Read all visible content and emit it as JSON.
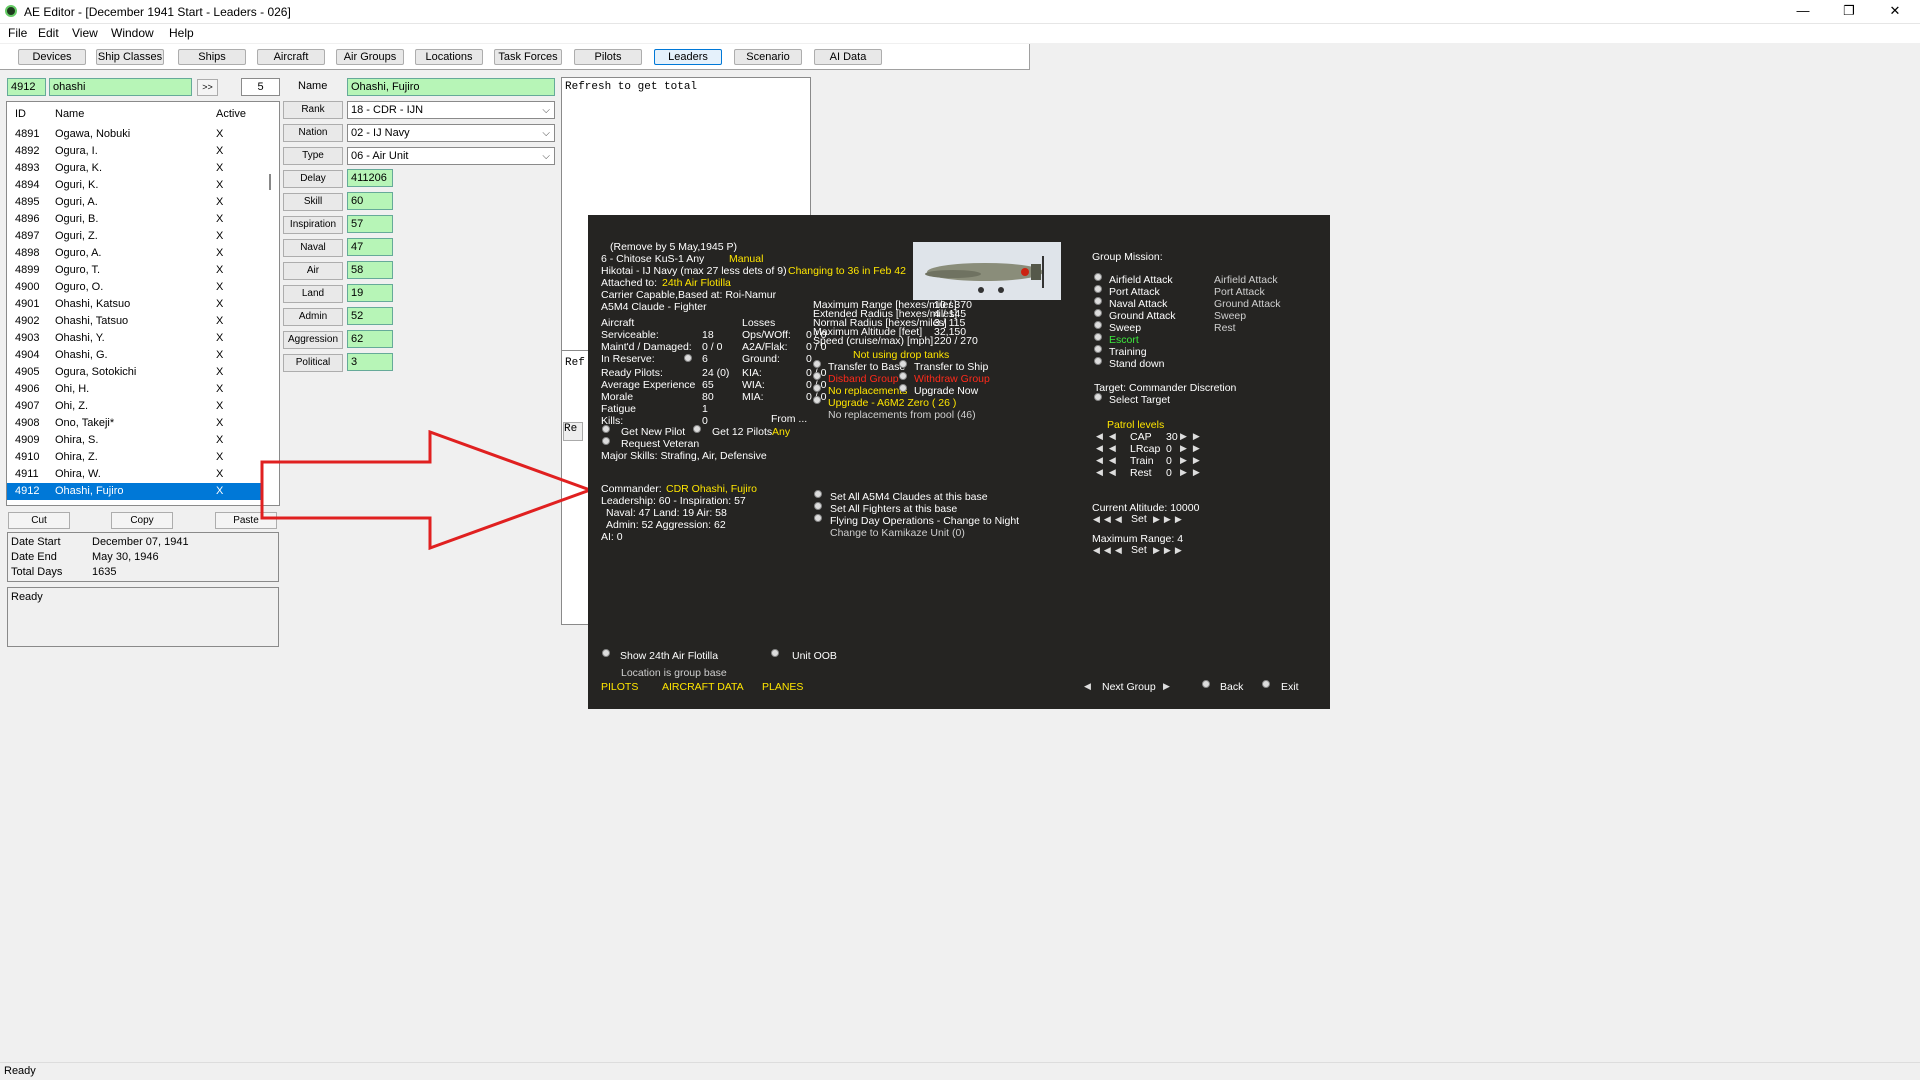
{
  "window": {
    "title": "AE Editor - [December 1941 Start - Leaders - 026]",
    "minimize": "—",
    "maximize": "❐",
    "close": "✕"
  },
  "menu": [
    "File",
    "Edit",
    "View",
    "Window",
    "Help"
  ],
  "tabs": [
    "Devices",
    "Ship Classes",
    "Ships",
    "Aircraft",
    "Air Groups",
    "Locations",
    "Task Forces",
    "Pilots",
    "Leaders",
    "Scenario",
    "AI Data"
  ],
  "active_tab": "Leaders",
  "search": {
    "id": "4912",
    "text": "ohashi",
    "go": ">>",
    "count": "5"
  },
  "list": {
    "headers": [
      "ID",
      "Name",
      "Active"
    ],
    "rows": [
      {
        "id": "4891",
        "name": "Ogawa, Nobuki",
        "active": "X"
      },
      {
        "id": "4892",
        "name": "Ogura, I.",
        "active": "X"
      },
      {
        "id": "4893",
        "name": "Ogura, K.",
        "active": "X"
      },
      {
        "id": "4894",
        "name": "Oguri, K.",
        "active": "X"
      },
      {
        "id": "4895",
        "name": "Oguri, A.",
        "active": "X"
      },
      {
        "id": "4896",
        "name": "Oguri, B.",
        "active": "X"
      },
      {
        "id": "4897",
        "name": "Oguri, Z.",
        "active": "X"
      },
      {
        "id": "4898",
        "name": "Oguro, A.",
        "active": "X"
      },
      {
        "id": "4899",
        "name": "Oguro, T.",
        "active": "X"
      },
      {
        "id": "4900",
        "name": "Oguro, O.",
        "active": "X"
      },
      {
        "id": "4901",
        "name": "Ohashi, Katsuo",
        "active": "X"
      },
      {
        "id": "4902",
        "name": "Ohashi, Tatsuo",
        "active": "X"
      },
      {
        "id": "4903",
        "name": "Ohashi, Y.",
        "active": "X"
      },
      {
        "id": "4904",
        "name": "Ohashi, G.",
        "active": "X"
      },
      {
        "id": "4905",
        "name": "Ogura, Sotokichi",
        "active": "X"
      },
      {
        "id": "4906",
        "name": "Ohi, H.",
        "active": "X"
      },
      {
        "id": "4907",
        "name": "Ohi, Z.",
        "active": "X"
      },
      {
        "id": "4908",
        "name": "Ono, Takeji*",
        "active": "X"
      },
      {
        "id": "4909",
        "name": "Ohira, S.",
        "active": "X"
      },
      {
        "id": "4910",
        "name": "Ohira, Z.",
        "active": "X"
      },
      {
        "id": "4911",
        "name": "Ohira, W.",
        "active": "X"
      },
      {
        "id": "4912",
        "name": "Ohashi, Fujiro",
        "active": "X"
      }
    ]
  },
  "buttons": {
    "cut": "Cut",
    "copy": "Copy",
    "paste": "Paste"
  },
  "dates": {
    "start_label": "Date Start",
    "start": "December 07, 1941",
    "end_label": "Date End",
    "end": "May 30, 1946",
    "days_label": "Total Days",
    "days": "1635"
  },
  "notes": "Ready",
  "form": {
    "name_label": "Name",
    "name": "Ohashi, Fujiro",
    "rank_label": "Rank",
    "rank": "18 - CDR - IJN",
    "nation_label": "Nation",
    "nation": "02 - IJ Navy",
    "type_label": "Type",
    "type": "06 - Air Unit",
    "fields": [
      {
        "label": "Delay",
        "value": "411206"
      },
      {
        "label": "Skill",
        "value": "60"
      },
      {
        "label": "Inspiration",
        "value": "57"
      },
      {
        "label": "Naval",
        "value": "47"
      },
      {
        "label": "Air",
        "value": "58"
      },
      {
        "label": "Land",
        "value": "19"
      },
      {
        "label": "Admin",
        "value": "52"
      },
      {
        "label": "Aggression",
        "value": "62"
      },
      {
        "label": "Political",
        "value": "3"
      }
    ]
  },
  "text_panel": {
    "top": "Refresh to get total",
    "mid": "Ref",
    "bot": "Re"
  },
  "game": {
    "remove": "(Remove by  5 May,1945  P)",
    "unit": "6 - Chitose KuS-1  Any",
    "manual": "Manual",
    "hikotai": "Hikotai - IJ Navy (max 27 less dets of 9)",
    "changing": "Changing to 36 in Feb 42",
    "attached_label": "Attached to:",
    "attached": "24th Air Flotilla",
    "carrier": "Carrier Capable,Based at:  Roi-Namur",
    "aircraft_type": "A5M4 Claude - Fighter",
    "aircraft_h": "Aircraft",
    "losses_h": "Losses",
    "serv_label": "Serviceable:",
    "serv": "18",
    "maint_label": "Maint'd / Damaged:",
    "maint": "0 / 0",
    "reserve_label": "In Reserve:",
    "reserve": "6",
    "ops_label": "Ops/WOff:",
    "ops": "0 / 0",
    "a2a_label": "A2A/Flak:",
    "a2a": "0 / 0",
    "ground_label": "Ground:",
    "ground": "0",
    "pilots_label": "Ready Pilots:",
    "pilots": "24 (0)",
    "exp_label": "Average Experience",
    "exp": "65",
    "morale_label": "Morale",
    "morale": "80",
    "fatigue_label": "Fatigue",
    "fatigue": "1",
    "kills_label": "Kills:",
    "kills": "0",
    "kia_label": "KIA:",
    "kia": "0 / 0",
    "wia_label": "WIA:",
    "wia": "0 / 0",
    "mia_label": "MIA:",
    "mia": "0 / 0",
    "from": "From ...",
    "get_new_pilot": "Get New Pilot",
    "get_12": "Get 12 Pilots",
    "any": "Any",
    "request_veteran": "Request Veteran",
    "major_skills": "Major Skills: Strafing, Air, Defensive",
    "range_labels": [
      "Maximum Range [hexes/miles]",
      "Extended Radius [hexes/miles]",
      "Normal Radius [hexes/miles]",
      "Maximum Altitude [feet]",
      "Speed (cruise/max) [mph]"
    ],
    "range_values": [
      "10 / 370",
      "4 / 145",
      "3 / 115",
      "32,150",
      "220 / 270"
    ],
    "drop_tanks": "Not using drop tanks",
    "transfer_base": "Transfer to Base",
    "transfer_ship": "Transfer to Ship",
    "disband": "Disband Group",
    "withdraw": "Withdraw Group",
    "no_replacements": "No replacements",
    "upgrade_now": "Upgrade Now",
    "upgrade": "Upgrade - A6M2 Zero  ( 26 )",
    "no_repl_pool": "No replacements from pool (46)",
    "commander_label": "Commander:",
    "commander": "CDR Ohashi, Fujiro",
    "leadership": "Leadership: 60 - Inspiration: 57",
    "naval_line": "Naval: 47  Land: 19  Air: 58",
    "admin_line": "Admin: 52  Aggression: 62",
    "ai_line": "AI: 0",
    "set_all_a5m4": "Set All A5M4 Claudes at this base",
    "set_all_fighters": "Set All Fighters at this base",
    "flying_day": "Flying Day Operations - Change to Night",
    "kamikaze": "Change to Kamikaze Unit (0)",
    "mission_title": "Group Mission:",
    "missions": [
      "Airfield Attack",
      "Port Attack",
      "Naval Attack",
      "Ground Attack",
      "Sweep",
      "Escort",
      "Training",
      "Stand down"
    ],
    "secondary": [
      "Airfield Attack",
      "Port Attack",
      "Ground Attack",
      "Sweep",
      "Rest"
    ],
    "target": "Target: Commander Discretion",
    "select_target": "Select Target",
    "patrol_title": "Patrol levels",
    "patrol": [
      {
        "l": "CAP",
        "v": "30"
      },
      {
        "l": "LRcap",
        "v": "0"
      },
      {
        "l": "Train",
        "v": "0"
      },
      {
        "l": "Rest",
        "v": "0"
      }
    ],
    "altitude": "Current Altitude: 10000",
    "max_range": "Maximum Range: 4",
    "set": "Set",
    "show_flotilla": "Show 24th Air Flotilla",
    "unit_oob": "Unit OOB",
    "location": "Location is group base",
    "pilots_link": "PILOTS",
    "aircraft_data": "AIRCRAFT DATA",
    "planes": "PLANES",
    "next_group": "Next Group",
    "back": "Back",
    "exit": "Exit"
  },
  "statusbar": "Ready",
  "colors": {
    "field_green": "#b7f5b7",
    "select_blue": "#0078d7",
    "game_bg": "#252422",
    "game_yellow": "#ffe600",
    "game_red": "#ff2a1a",
    "arrow_red": "#e02020"
  }
}
